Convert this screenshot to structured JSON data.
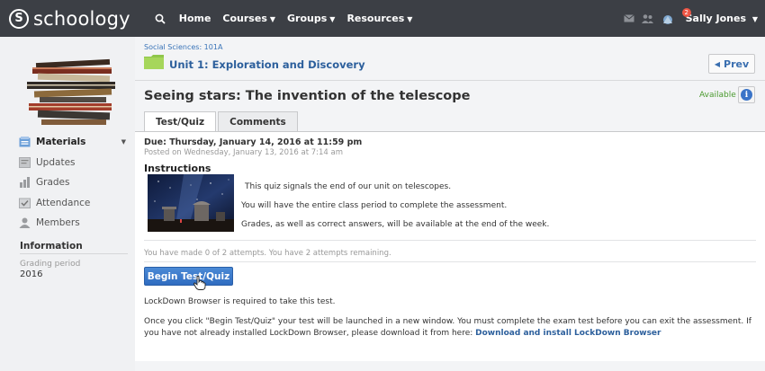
{
  "brand": {
    "logo_letter": "S",
    "name": "schoology"
  },
  "topnav": {
    "items": [
      {
        "label": "Home",
        "caret": false
      },
      {
        "label": "Courses",
        "caret": true
      },
      {
        "label": "Groups",
        "caret": true
      },
      {
        "label": "Resources",
        "caret": true
      }
    ],
    "notification_count": "2",
    "user_name": "Sally Jones"
  },
  "sidebar": {
    "items": [
      {
        "label": "Materials",
        "icon": "materials-icon",
        "active": true
      },
      {
        "label": "Updates",
        "icon": "updates-icon",
        "active": false
      },
      {
        "label": "Grades",
        "icon": "grades-icon",
        "active": false
      },
      {
        "label": "Attendance",
        "icon": "attendance-icon",
        "active": false
      },
      {
        "label": "Members",
        "icon": "members-icon",
        "active": false
      }
    ],
    "info_heading": "Information",
    "grading_period_label": "Grading period",
    "grading_period_value": "2016"
  },
  "header": {
    "breadcrumb": "Social Sciences: 101A",
    "unit_title": "Unit 1: Exploration and Discovery",
    "prev_label": "Prev",
    "page_title": "Seeing stars: The invention of the telescope",
    "status": "Available"
  },
  "tabs": [
    {
      "label": "Test/Quiz",
      "active": true
    },
    {
      "label": "Comments",
      "active": false
    }
  ],
  "quiz": {
    "due": "Due: Thursday, January 14, 2016 at 11:59 pm",
    "posted": "Posted on Wednesday, January 13, 2016 at 7:14 am",
    "instructions_heading": "Instructions",
    "lines": [
      "This quiz signals the end of our unit on telescopes.",
      "You will have the entire class period to complete the assessment.",
      "Grades, as well as correct answers, will be available at the end of the week."
    ],
    "attempts": "You have made 0 of 2 attempts. You have 2 attempts remaining.",
    "begin_label": "Begin Test/Quiz",
    "lockdown_note": "LockDown Browser is required to take this test.",
    "launch_note": "Once you click \"Begin Test/Quiz\" your test will be launched in a new window. You must complete the exam test before you can exit the assessment. If you have not already installed LockDown Browser, please download it from here:",
    "download_link": "Download and install LockDown Browser"
  },
  "colors": {
    "topbar": "#3c3f45",
    "link": "#2c5f9c",
    "button": "#3a74c8",
    "available": "#4a9a2e"
  }
}
